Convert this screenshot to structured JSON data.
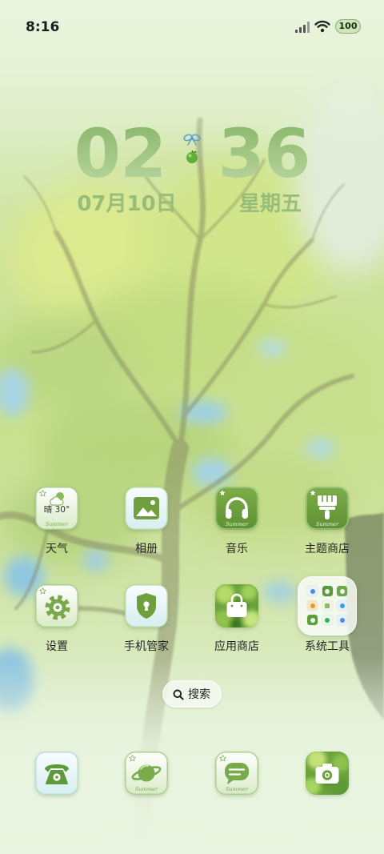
{
  "status_bar": {
    "time": "8:16",
    "battery": "100"
  },
  "clock": {
    "hour": "02",
    "minute": "36",
    "date": "07月10日",
    "weekday": "星期五"
  },
  "apps": [
    {
      "label": "天气",
      "icon": "weather-icon",
      "icon_text": "晴 30°",
      "brand": "Summer"
    },
    {
      "label": "相册",
      "icon": "gallery-icon"
    },
    {
      "label": "音乐",
      "icon": "headphones-icon",
      "brand": "Summer"
    },
    {
      "label": "主题商店",
      "icon": "paintbrush-icon",
      "brand": "Summer"
    },
    {
      "label": "设置",
      "icon": "gear-icon"
    },
    {
      "label": "手机管家",
      "icon": "shield-icon"
    },
    {
      "label": "应用商店",
      "icon": "shopping-bag-icon"
    },
    {
      "label": "系统工具",
      "icon": "folder-icon"
    }
  ],
  "search": {
    "label": "搜索",
    "icon": "search-icon"
  },
  "dock": [
    {
      "icon": "phone-icon"
    },
    {
      "icon": "browser-icon",
      "brand": "Summer"
    },
    {
      "icon": "message-icon",
      "brand": "Summer"
    },
    {
      "icon": "camera-icon"
    }
  ],
  "colors": {
    "accent": "#6f9f3f",
    "clock_text": "#97bd78",
    "label_text": "#262626"
  }
}
